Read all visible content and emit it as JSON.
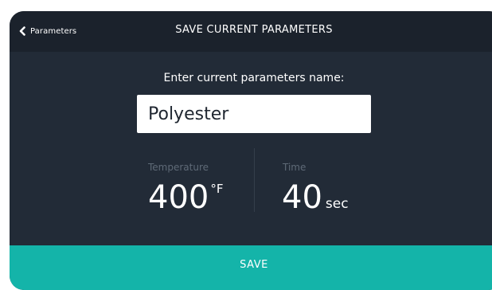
{
  "header": {
    "back_label": "Parameters",
    "title": "SAVE CURRENT PARAMETERS"
  },
  "form": {
    "prompt": "Enter current parameters name:",
    "name_value": "Polyester"
  },
  "metrics": {
    "temperature": {
      "label": "Temperature",
      "value": "400",
      "unit": "°F"
    },
    "time": {
      "label": "Time",
      "value": "40",
      "unit": "sec"
    }
  },
  "actions": {
    "save_label": "SAVE"
  },
  "colors": {
    "background": "#222b37",
    "header": "#1b222c",
    "accent": "#14b4a9",
    "label_muted": "#5f6a77"
  },
  "icons": {
    "back": "chevron-left-icon"
  }
}
